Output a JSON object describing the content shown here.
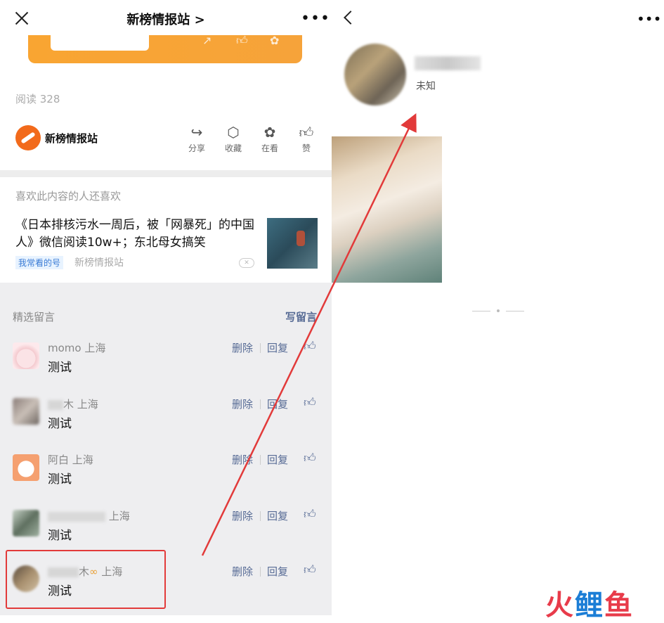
{
  "left": {
    "title": "新榜情报站 >",
    "read_count": "阅读 328",
    "account_name": "新榜情报站",
    "actions": [
      {
        "label": "分享",
        "icon": "share-icon"
      },
      {
        "label": "收藏",
        "icon": "box-icon"
      },
      {
        "label": "在看",
        "icon": "flower-icon"
      },
      {
        "label": "赞",
        "icon": "thumbs-up-icon"
      }
    ],
    "recommend": {
      "heading": "喜欢此内容的人还喜欢",
      "article_title": "《日本排核污水一周后，被「网暴死」的中国人》微信阅读10w+；东北母女搞笑",
      "tag": "我常看的号",
      "source": "新榜情报站"
    },
    "comments": {
      "heading": "精选留言",
      "write_label": "写留言",
      "delete_label": "删除",
      "reply_label": "回复",
      "items": [
        {
          "name": "momo",
          "location": "上海",
          "text": "测试"
        },
        {
          "name": "木",
          "location": "上海",
          "text": "测试"
        },
        {
          "name": "阿白",
          "location": "上海",
          "text": "测试"
        },
        {
          "name": "",
          "location": "上海",
          "text": "测试"
        },
        {
          "name": "木",
          "location": "上海",
          "text": "测试"
        }
      ]
    }
  },
  "right": {
    "region": "未知"
  },
  "watermark": {
    "part1": "火",
    "part2": "鲤",
    "part3": "鱼"
  },
  "colors": {
    "link": "#576b95",
    "highlight": "#e23a3a",
    "brand_orange": "#f26a1b"
  }
}
